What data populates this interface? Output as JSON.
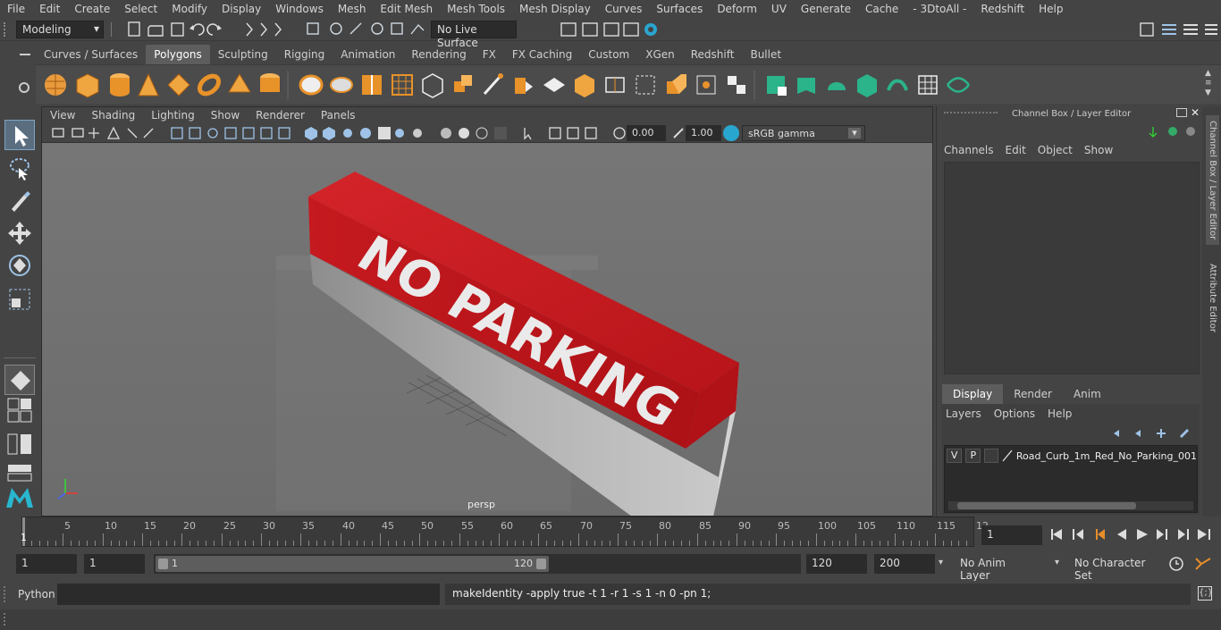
{
  "menubar": [
    "File",
    "Edit",
    "Create",
    "Select",
    "Modify",
    "Display",
    "Windows",
    "Mesh",
    "Edit Mesh",
    "Mesh Tools",
    "Mesh Display",
    "Curves",
    "Surfaces",
    "Deform",
    "UV",
    "Generate",
    "Cache",
    "- 3DtoAll -",
    "Redshift",
    "Help"
  ],
  "status": {
    "mode": "Modeling",
    "live_surface": "No Live Surface"
  },
  "shelf_tabs": [
    "Curves / Surfaces",
    "Polygons",
    "Sculpting",
    "Rigging",
    "Animation",
    "Rendering",
    "FX",
    "FX Caching",
    "Custom",
    "XGen",
    "Redshift",
    "Bullet"
  ],
  "shelf_active": "Polygons",
  "viewport": {
    "menu": [
      "View",
      "Shading",
      "Lighting",
      "Show",
      "Renderer",
      "Panels"
    ],
    "exposure": "0.00",
    "gamma": "1.00",
    "color_space": "sRGB gamma",
    "camera_label": "persp",
    "object_text": "NO PARKING"
  },
  "channel_box": {
    "title": "Channel Box / Layer Editor",
    "menu": [
      "Channels",
      "Edit",
      "Object",
      "Show"
    ],
    "layer_tabs": [
      "Display",
      "Render",
      "Anim"
    ],
    "layer_menu": [
      "Layers",
      "Options",
      "Help"
    ],
    "layer": {
      "v": "V",
      "p": "P",
      "name": "Road_Curb_1m_Red_No_Parking_001"
    }
  },
  "side_tabs": [
    "Channel Box / Layer Editor",
    "Attribute Editor"
  ],
  "timeline": {
    "ticks": [
      "5",
      "10",
      "15",
      "20",
      "25",
      "30",
      "35",
      "40",
      "45",
      "50",
      "55",
      "60",
      "65",
      "70",
      "75",
      "80",
      "85",
      "90",
      "95",
      "100",
      "105",
      "110",
      "115",
      "12"
    ],
    "start_label": "1",
    "current_frame": "1"
  },
  "range": {
    "start": "1",
    "playback_start": "1",
    "slider_start": "1",
    "slider_end": "120",
    "playback_end": "120",
    "end": "200",
    "anim_layer": "No Anim Layer",
    "character_set": "No Character Set"
  },
  "command": {
    "language": "Python",
    "result": "makeIdentity -apply true -t 1 -r 1 -s 1 -n 0 -pn 1;"
  },
  "colors": {
    "accent": "#5285a6",
    "curb_red": "#c8161b",
    "curb_grey": "#a9a9a9"
  }
}
